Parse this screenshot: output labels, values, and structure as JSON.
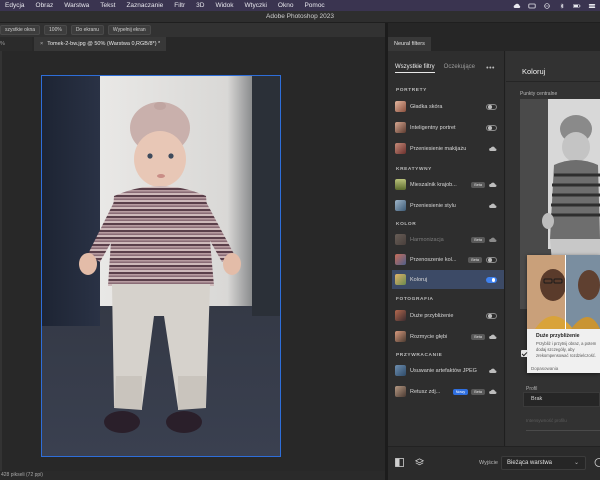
{
  "menubar": {
    "items": [
      "Edycja",
      "Obraz",
      "Warstwa",
      "Tekst",
      "Zaznaczanie",
      "Filtr",
      "3D",
      "Widok",
      "Wtyczki",
      "Okno",
      "Pomoc"
    ],
    "icons": [
      "creative-cloud-icon",
      "menu-extra-icon",
      "globe-icon",
      "bluetooth-icon",
      "battery-icon",
      "control-center-icon"
    ]
  },
  "window": {
    "title": "Adobe Photoshop 2023"
  },
  "options_bar": {
    "buttons": [
      "szystkie okna",
      "100%",
      "Do ekranu",
      "Wypełnij ekran"
    ]
  },
  "doc_tabs": {
    "first": "% (RGB/8*)",
    "active": "Tomek-2-bw.jpg @ 50% (Warstwa 0,RGB/8*) *"
  },
  "status_bar": {
    "text": "428 pikseli (72 ppi)"
  },
  "neural_filters": {
    "panel_title": "Neural filters",
    "tabs": {
      "all": "Wszystkie filtry",
      "waiting": "Oczekujące",
      "more": "•••"
    },
    "categories": {
      "portrety": "PORTRETY",
      "kreatywny": "KREATYWNY",
      "kolor": "KOLOR",
      "fotografia": "FOTOGRAFIA",
      "przywracanie": "PRZYWRACANIE"
    },
    "filters": [
      {
        "label": "Gładka skóra"
      },
      {
        "label": "Inteligentny portret"
      },
      {
        "label": "Przeniesienie makijażu"
      },
      {
        "label": "Mieszalnik krajob...",
        "badge": "Beta"
      },
      {
        "label": "Przeniesienie stylu"
      },
      {
        "label": "Harmonizacja",
        "badge": "Beta"
      },
      {
        "label": "Przenoszenie kol...",
        "badge": "Beta"
      },
      {
        "label": "Koloruj"
      },
      {
        "label": "Duże przybliżenie"
      },
      {
        "label": "Rozmycie głębi",
        "badge": "Beta"
      },
      {
        "label": "Usuwanie artefaktów JPEG"
      },
      {
        "label": "Retusz zdj...",
        "badge_new": "Nowy",
        "badge": "Beta"
      }
    ],
    "detail": {
      "title": "Koloruj",
      "points_label": "Punkty centralne",
      "tooltip_title": "Duże przybliżenie",
      "tooltip_desc": "Przybliż i przytnij obraz, a potem dodaj szczegóły, aby zrekompensować rozdzielczość.",
      "ghost_label": "Dopasowania",
      "profile_label": "Profil",
      "profile_value": "Brak",
      "ghost_label2": "Intensywność profilu"
    },
    "output": {
      "label": "Wyjście",
      "value": "Bieżąca warstwa"
    }
  },
  "colors": {
    "accent": "#3f82f0",
    "selected_row": "#3c4a66",
    "canvas_bg": "#282828",
    "panel_bg": "#303030"
  }
}
